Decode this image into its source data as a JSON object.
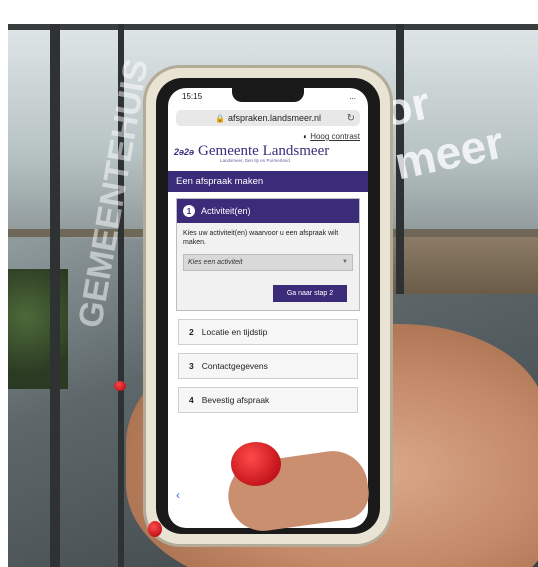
{
  "status_bar": {
    "time": "15:15",
    "indicators": "..."
  },
  "browser": {
    "url": "afspraken.landsmeer.nl",
    "lock_icon": "lock-icon",
    "reload_icon": "reload-icon"
  },
  "page": {
    "contrast_label": "Hoog contrast",
    "logo_name": "Gemeente Landsmeer",
    "logo_tagline": "Landsmeer, Den Ilp en Purmerland",
    "title": "Een afspraak maken",
    "active_step": {
      "number": "1",
      "label": "Activiteit(en)",
      "instruction": "Kies uw activiteit(en) waarvoor u een afspraak wilt maken.",
      "select_placeholder": "Kies een activiteit",
      "next_button": "Ga naar stap 2"
    },
    "steps": [
      {
        "number": "2",
        "label": "Locatie en tijdstip"
      },
      {
        "number": "3",
        "label": "Contactgegevens"
      },
      {
        "number": "4",
        "label": "Bevestig afspraak"
      }
    ],
    "back_icon": "back-chevron-icon"
  },
  "background": {
    "reflection_text_right": "or meer",
    "reflection_text_left": "GEMEENTEHUIS"
  },
  "colors": {
    "brand": "#3b2c7a",
    "nail": "#d61f26"
  }
}
